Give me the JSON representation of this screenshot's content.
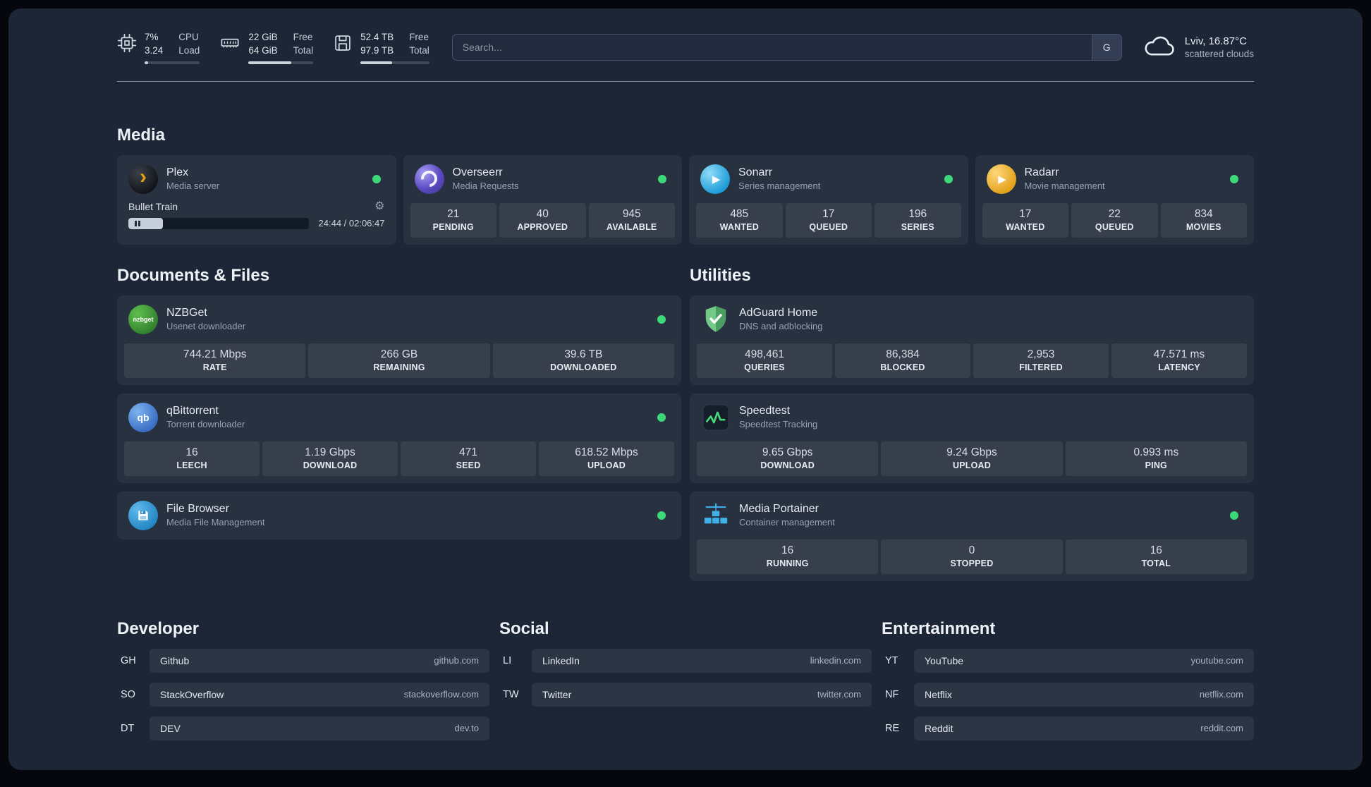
{
  "topbar": {
    "cpu": {
      "percent": "7%",
      "load": "3.24",
      "label_top": "CPU",
      "label_bottom": "Load",
      "bar_pct": 7
    },
    "memory": {
      "free": "22 GiB",
      "total": "64 GiB",
      "label_top": "Free",
      "label_bottom": "Total",
      "bar_pct": 66
    },
    "disk": {
      "free": "52.4 TB",
      "total": "97.9 TB",
      "label_top": "Free",
      "label_bottom": "Total",
      "bar_pct": 46
    },
    "search": {
      "placeholder": "Search...",
      "button_label": "G"
    },
    "weather": {
      "location": "Lviv, 16.87°C",
      "condition": "scattered clouds"
    }
  },
  "sections": {
    "media": {
      "title": "Media"
    },
    "documents": {
      "title": "Documents & Files"
    },
    "utilities": {
      "title": "Utilities"
    }
  },
  "services": {
    "plex": {
      "name": "Plex",
      "desc": "Media server",
      "player": {
        "title": "Bullet Train",
        "time": "24:44 / 02:06:47",
        "progress_pct": 19
      }
    },
    "overseerr": {
      "name": "Overseerr",
      "desc": "Media Requests",
      "stats": [
        {
          "value": "21",
          "label": "PENDING"
        },
        {
          "value": "40",
          "label": "APPROVED"
        },
        {
          "value": "945",
          "label": "AVAILABLE"
        }
      ]
    },
    "sonarr": {
      "name": "Sonarr",
      "desc": "Series management",
      "stats": [
        {
          "value": "485",
          "label": "WANTED"
        },
        {
          "value": "17",
          "label": "QUEUED"
        },
        {
          "value": "196",
          "label": "SERIES"
        }
      ]
    },
    "radarr": {
      "name": "Radarr",
      "desc": "Movie management",
      "stats": [
        {
          "value": "17",
          "label": "WANTED"
        },
        {
          "value": "22",
          "label": "QUEUED"
        },
        {
          "value": "834",
          "label": "MOVIES"
        }
      ]
    },
    "nzbget": {
      "name": "NZBGet",
      "desc": "Usenet downloader",
      "stats": [
        {
          "value": "744.21 Mbps",
          "label": "RATE"
        },
        {
          "value": "266 GB",
          "label": "REMAINING"
        },
        {
          "value": "39.6 TB",
          "label": "DOWNLOADED"
        }
      ]
    },
    "qbittorrent": {
      "name": "qBittorrent",
      "desc": "Torrent downloader",
      "stats": [
        {
          "value": "16",
          "label": "LEECH"
        },
        {
          "value": "1.19 Gbps",
          "label": "DOWNLOAD"
        },
        {
          "value": "471",
          "label": "SEED"
        },
        {
          "value": "618.52 Mbps",
          "label": "UPLOAD"
        }
      ]
    },
    "filebrowser": {
      "name": "File Browser",
      "desc": "Media File Management"
    },
    "adguard": {
      "name": "AdGuard Home",
      "desc": "DNS and adblocking",
      "stats": [
        {
          "value": "498,461",
          "label": "QUERIES"
        },
        {
          "value": "86,384",
          "label": "BLOCKED"
        },
        {
          "value": "2,953",
          "label": "FILTERED"
        },
        {
          "value": "47.571 ms",
          "label": "LATENCY"
        }
      ]
    },
    "speedtest": {
      "name": "Speedtest",
      "desc": "Speedtest Tracking",
      "stats": [
        {
          "value": "9.65 Gbps",
          "label": "DOWNLOAD"
        },
        {
          "value": "9.24 Gbps",
          "label": "UPLOAD"
        },
        {
          "value": "0.993 ms",
          "label": "PING"
        }
      ]
    },
    "portainer": {
      "name": "Media Portainer",
      "desc": "Container management",
      "stats": [
        {
          "value": "16",
          "label": "RUNNING"
        },
        {
          "value": "0",
          "label": "STOPPED"
        },
        {
          "value": "16",
          "label": "TOTAL"
        }
      ]
    }
  },
  "bookmarks": {
    "developer": {
      "title": "Developer",
      "items": [
        {
          "abbr": "GH",
          "name": "Github",
          "url": "github.com"
        },
        {
          "abbr": "SO",
          "name": "StackOverflow",
          "url": "stackoverflow.com"
        },
        {
          "abbr": "DT",
          "name": "DEV",
          "url": "dev.to"
        }
      ]
    },
    "social": {
      "title": "Social",
      "items": [
        {
          "abbr": "LI",
          "name": "LinkedIn",
          "url": "linkedin.com"
        },
        {
          "abbr": "TW",
          "name": "Twitter",
          "url": "twitter.com"
        }
      ]
    },
    "entertainment": {
      "title": "Entertainment",
      "items": [
        {
          "abbr": "YT",
          "name": "YouTube",
          "url": "youtube.com"
        },
        {
          "abbr": "NF",
          "name": "Netflix",
          "url": "netflix.com"
        },
        {
          "abbr": "RE",
          "name": "Reddit",
          "url": "reddit.com"
        }
      ]
    }
  },
  "glyphs": {
    "play": "▶",
    "plex": "›",
    "gear": "⚙",
    "nzbget": "nzbget",
    "qb": "qb"
  },
  "colors": {
    "status_online": "#3dd979",
    "plex_accent": "#e5a00d",
    "adguard_green": "#5fb276",
    "speedtest_green": "#46d879",
    "portainer_blue": "#3fb0e8"
  }
}
